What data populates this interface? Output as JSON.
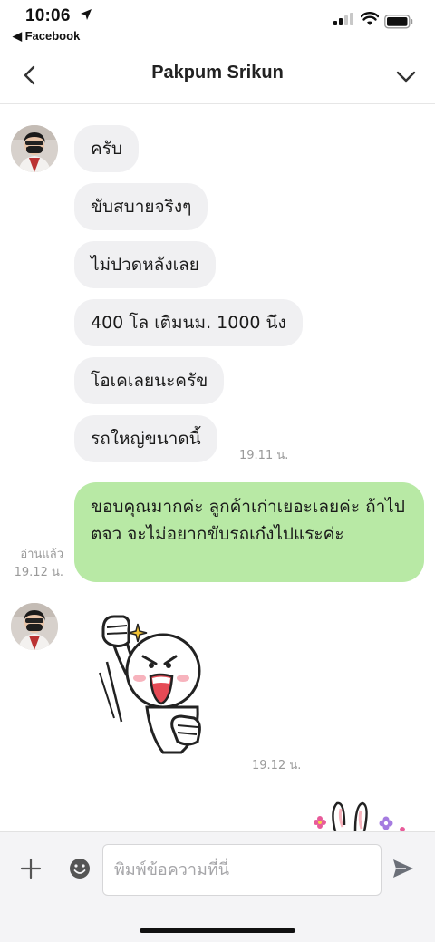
{
  "status_bar": {
    "time": "10:06",
    "back_app": "◀ Facebook"
  },
  "header": {
    "title": "Pakpum Srikun"
  },
  "messages_in_1": [
    "ครับ",
    "ขับสบายจริงๆ",
    "ไม่ปวดหลังเลย",
    "400 โล เติมนม. 1000 นึง",
    "โอเคเลยนะครัข",
    "รถใหญ่ขนาดนี้"
  ],
  "timestamps": {
    "in_1": "19.11 น.",
    "out_1": "19.12 น.",
    "sticker": "19.12 น."
  },
  "outgoing": {
    "text": "ขอบคุณมากค่ะ ลูกค้าเก่าเยอะเลยค่ะ ถ้าไป ตจว จะไม่อยากขับรถเก๋งไปแระค่ะ",
    "read_label": "อ่านแล้ว"
  },
  "input": {
    "placeholder": "พิมพ์ข้อความที่นี่"
  },
  "colors": {
    "incoming_bubble": "#f0f0f2",
    "outgoing_bubble": "#b8e9a5",
    "timestamp": "#9a9a9a"
  },
  "icons": [
    "location-arrow-icon",
    "signal-icon",
    "wifi-icon",
    "battery-icon",
    "back-chevron-icon",
    "chevron-down-icon",
    "plus-icon",
    "emoji-icon",
    "send-icon"
  ]
}
